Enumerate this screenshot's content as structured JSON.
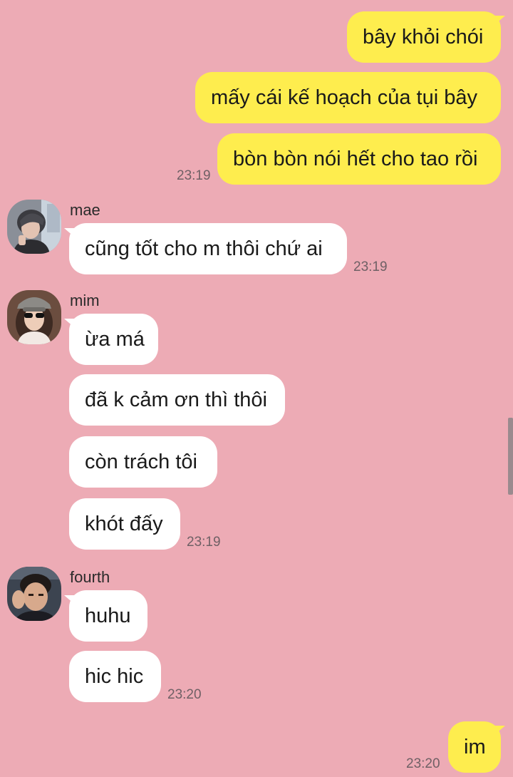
{
  "chat": {
    "outgoing_top": {
      "msg1": "bây khỏi chói",
      "msg2": "mấy cái kế hoạch của tụi bây",
      "msg3": "bòn bòn nói hết cho tao rồi",
      "time": "23:19"
    },
    "mae": {
      "name": "mae",
      "msg1": "cũng tốt cho m thôi chứ ai",
      "time": "23:19"
    },
    "mim": {
      "name": "mim",
      "msg1": "ừa má",
      "msg2": "đã k cảm ơn thì thôi",
      "msg3": "còn trách tôi",
      "msg4": "khót đấy",
      "time": "23:19"
    },
    "fourth": {
      "name": "fourth",
      "msg1": "huhu",
      "msg2": "hic hic",
      "time": "23:20"
    },
    "outgoing_bottom": {
      "msg1": "im",
      "time": "23:20"
    }
  },
  "colors": {
    "background": "#EDABB5",
    "outgoing_bubble": "#FEED4E",
    "incoming_bubble": "#FFFFFF",
    "timestamp": "#6F6065"
  },
  "icons": {
    "mae_avatar": "user-photo-avatar",
    "mim_avatar": "user-photo-avatar",
    "fourth_avatar": "user-photo-avatar"
  }
}
